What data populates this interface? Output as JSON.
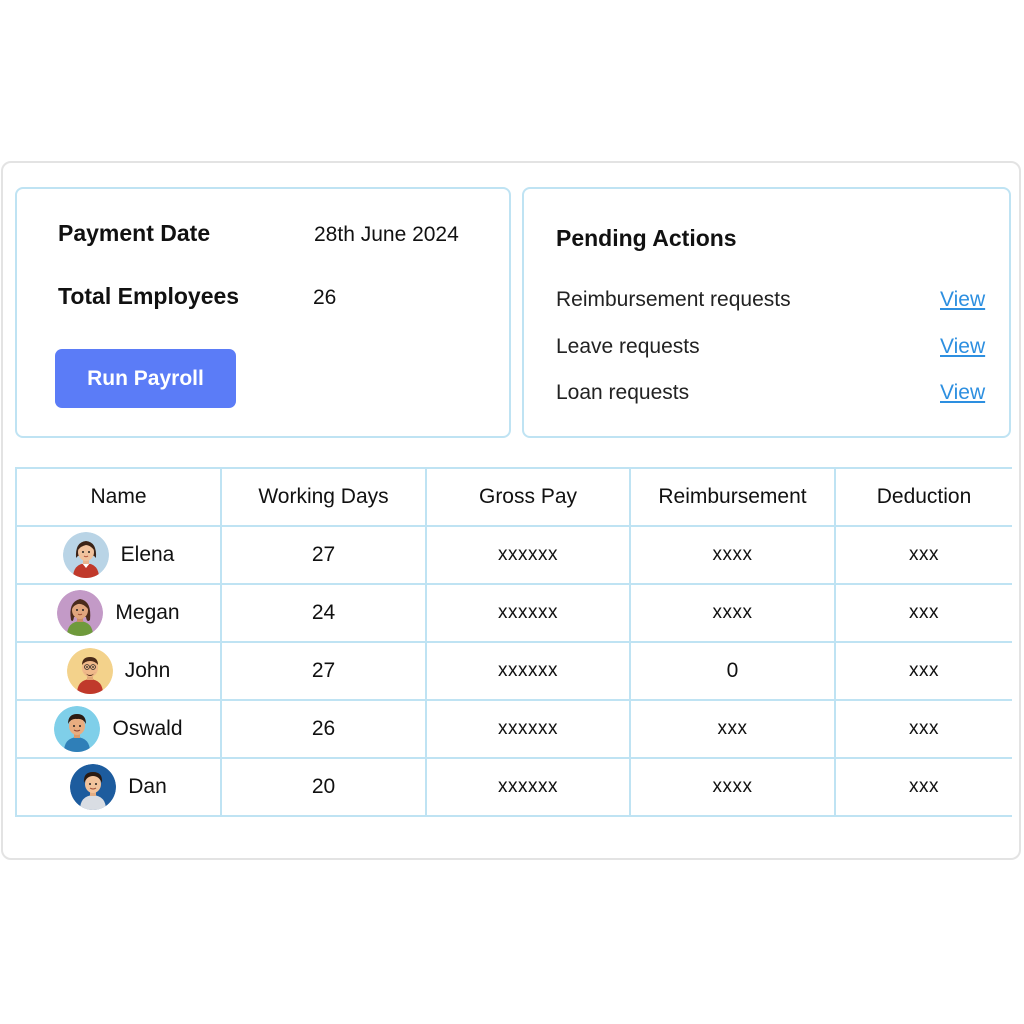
{
  "summary": {
    "payment_date_label": "Payment Date",
    "payment_date_value": "28th June 2024",
    "total_employees_label": "Total Employees",
    "total_employees_value": "26",
    "run_payroll_label": "Run Payroll",
    "button_color": "#5b7cf7"
  },
  "pending": {
    "title": "Pending Actions",
    "items": [
      {
        "label": "Reimbursement requests",
        "link": "View"
      },
      {
        "label": "Leave requests",
        "link": "View"
      },
      {
        "label": "Loan requests",
        "link": "View"
      }
    ],
    "link_color": "#2d8fe0"
  },
  "table": {
    "headers": [
      "Name",
      "Working Days",
      "Gross Pay",
      "Reimbursement",
      "Deduction"
    ],
    "rows": [
      {
        "name": "Elena",
        "avatar": "female-avatar-icon",
        "working_days": "27",
        "gross_pay": "xxxxxx",
        "reimbursement": "xxxx",
        "deduction": "xxx"
      },
      {
        "name": "Megan",
        "avatar": "female-avatar-icon",
        "working_days": "24",
        "gross_pay": "xxxxxx",
        "reimbursement": "xxxx",
        "deduction": "xxx"
      },
      {
        "name": "John",
        "avatar": "male-avatar-icon",
        "working_days": "27",
        "gross_pay": "xxxxxx",
        "reimbursement": "0",
        "deduction": "xxx"
      },
      {
        "name": "Oswald",
        "avatar": "male-avatar-icon",
        "working_days": "26",
        "gross_pay": "xxxxxx",
        "reimbursement": "xxx",
        "deduction": "xxx"
      },
      {
        "name": "Dan",
        "avatar": "male-avatar-icon",
        "working_days": "20",
        "gross_pay": "xxxxxx",
        "reimbursement": "xxxx",
        "deduction": "xxx"
      }
    ],
    "border_color": "#bfe3f3"
  }
}
